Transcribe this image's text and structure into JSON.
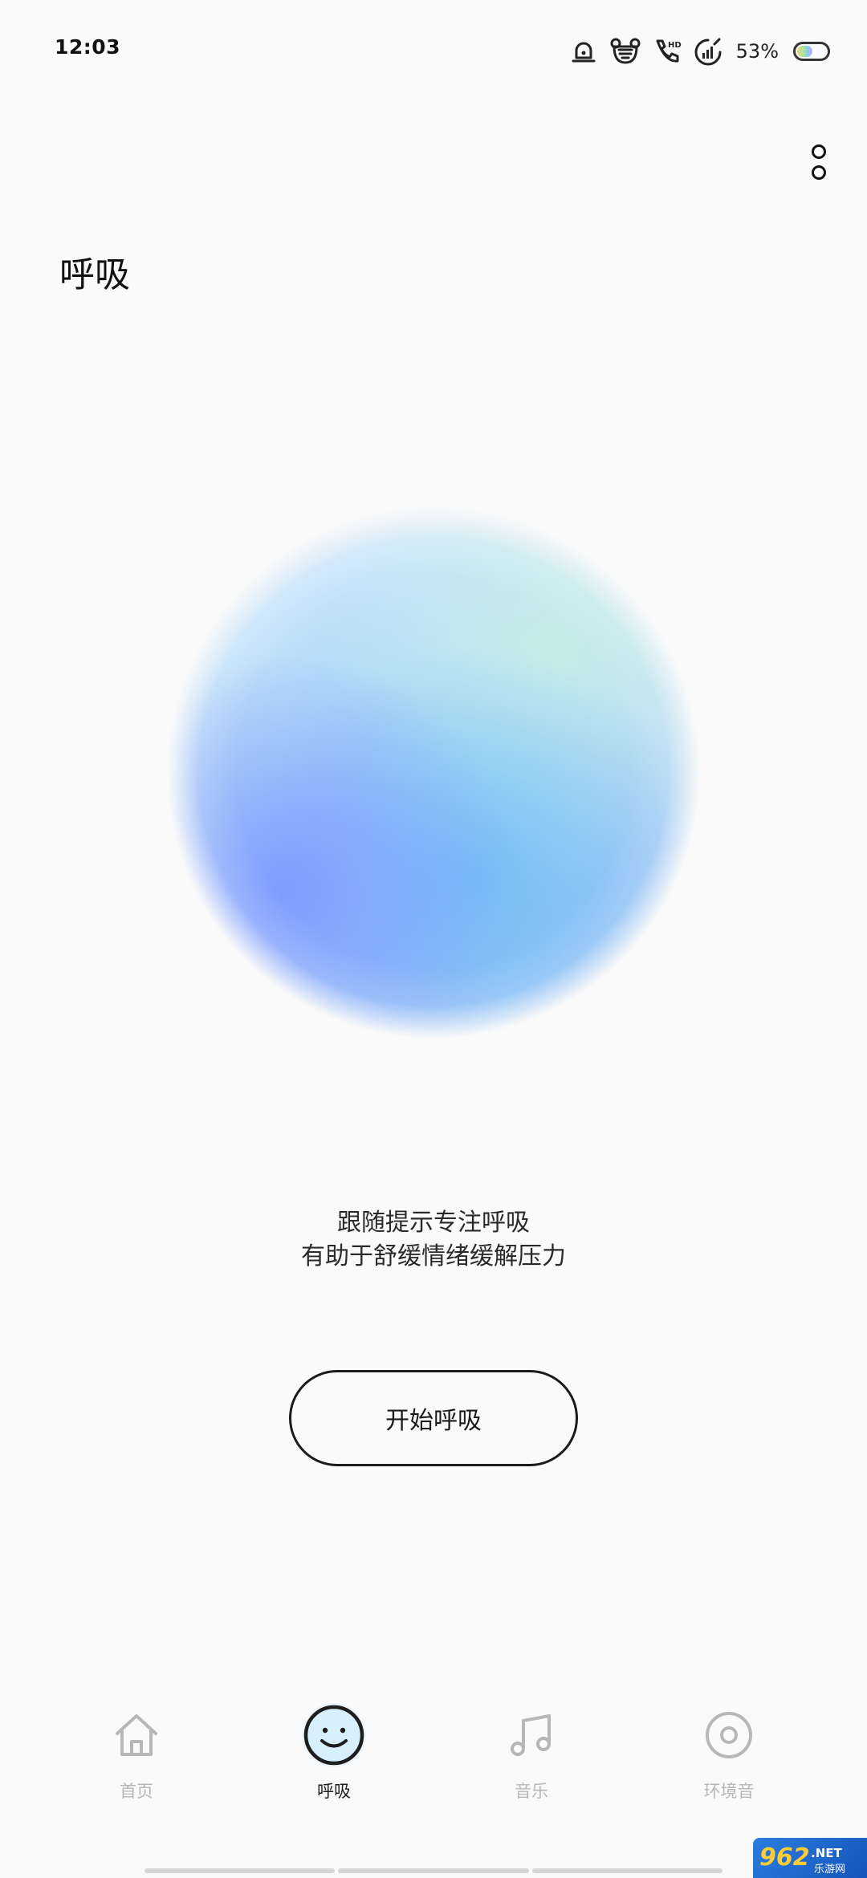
{
  "status_bar": {
    "time": "12:03",
    "battery_percent": "53%",
    "battery_level": 0.53,
    "icons": [
      "alarm-icon",
      "bear-icon",
      "hd-call-icon",
      "signal-icon"
    ]
  },
  "header": {
    "title": "呼吸",
    "more_icon": "more-vertical-icon"
  },
  "breathing": {
    "description_lines": [
      "跟随提示专注呼吸",
      "有助于舒缓情绪缓解压力"
    ],
    "start_label": "开始呼吸"
  },
  "bottom_nav": {
    "items": [
      {
        "label": "首页",
        "icon": "home-icon",
        "active": false
      },
      {
        "label": "呼吸",
        "icon": "smile-icon",
        "active": true
      },
      {
        "label": "音乐",
        "icon": "music-note-icon",
        "active": false
      },
      {
        "label": "环境音",
        "icon": "disc-icon",
        "active": false
      }
    ]
  },
  "watermark": {
    "text": "962",
    "suffix": ".NET",
    "sub": "乐游网"
  },
  "colors": {
    "background": "#fafafa",
    "text": "#1e1e1e",
    "nav_inactive": "#b7b7b7",
    "active_icon_fill": "#d8f0fb",
    "orb_blue": "#7c98ff",
    "orb_cyan": "#6ebef5",
    "orb_mint": "#c8eee8"
  }
}
